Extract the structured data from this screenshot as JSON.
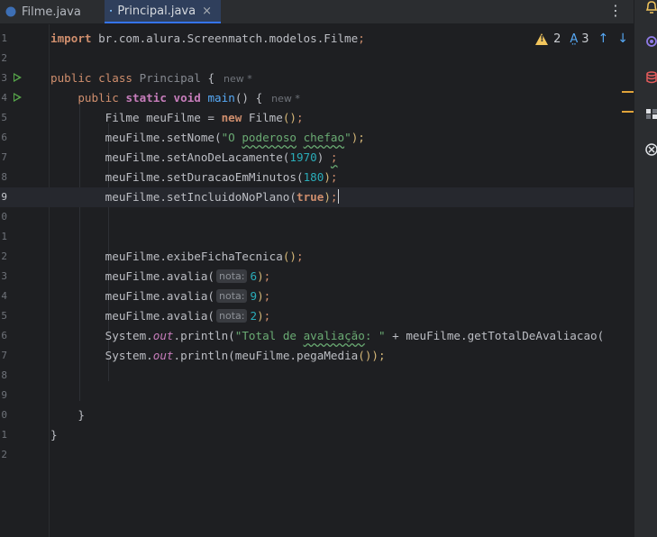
{
  "tabs": [
    {
      "label": "Filme.java",
      "active": false
    },
    {
      "label": "Principal.java",
      "active": true,
      "close": "×"
    }
  ],
  "menu_glyph": "⋮",
  "inspection": {
    "warnings": "2",
    "typos": "3",
    "up": "↑",
    "down": "↓"
  },
  "line_numbers": [
    "1",
    "2",
    "3",
    "4",
    "5",
    "6",
    "7",
    "8",
    "9",
    "0",
    "1",
    "2",
    "3",
    "4",
    "5",
    "6",
    "7",
    "8",
    "9",
    "0",
    "1",
    "2"
  ],
  "current_line_index": 8,
  "code": {
    "import_kw": "import",
    "import_path": " br.com.alura.Screenmatch.modelos.Filme",
    "semicolon": ";",
    "public_kw": "public",
    "class_kw": "class",
    "class_name": "Principal",
    "open_brace": "{",
    "new_hint": "new *",
    "static_kw": "static",
    "void_kw": "void",
    "main_name": "main",
    "main_params": "()",
    "line5_type": "Filme meuFilme = ",
    "new_kw": "new",
    "line5_ctor": "Filme",
    "line6_obj": "meuFilme.setNome(",
    "line6_str_open": "\"O ",
    "line6_str_w1": "poderoso",
    "line6_str_sp": " ",
    "line6_str_w2": "chefao",
    "line6_str_close": "\"",
    "line6_end": ");",
    "line7_obj": "meuFilme.setAnoDeLacamente(",
    "line7_num": "1970",
    "line7_close": ") ",
    "line8_obj": "meuFilme.setDuracaoEmMinutos(",
    "line8_num": "180",
    "line9_obj": "meuFilme.setIncluidoNoPlano(",
    "true_kw": "true",
    "line12_call": "meuFilme.exibeFichaTecnica",
    "avalia_call": "meuFilme.avalia(",
    "param_hint": "nota:",
    "avalia_values": [
      "6",
      "9",
      "2"
    ],
    "system": "System.",
    "out": "out",
    "println": ".println(",
    "line16_str_open": "\"Total de ",
    "line16_str_word": "avaliação",
    "line16_str_close": ": \"",
    "line16_rest": " + meuFilme.getTotalDeAvaliacao(",
    "line17_arg": "meuFilme.pegaMedia",
    "line17_end": "());",
    "close_brace": "}"
  }
}
